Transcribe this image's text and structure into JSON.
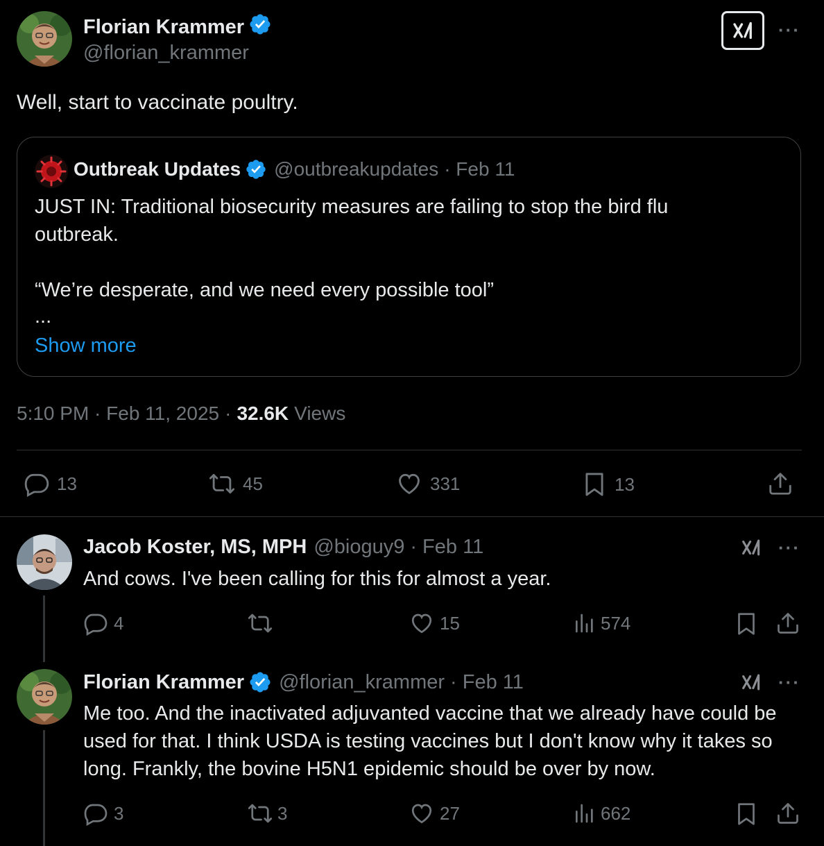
{
  "colors": {
    "background": "#000000",
    "text": "#e7e9ea",
    "muted": "#71767b",
    "accent": "#1d9bf0",
    "border": "#2f3336"
  },
  "main_tweet": {
    "author_name": "Florian Krammer",
    "author_handle": "@florian_krammer",
    "text": "Well, start to vaccinate poultry.",
    "timestamp": "5:10 PM · Feb 11, 2025",
    "views_count": "32.6K",
    "views_label": "Views",
    "quote": {
      "author_name": "Outbreak Updates",
      "author_handle": "@outbreakupdates",
      "date": "· Feb 11",
      "line1": "JUST IN: Traditional biosecurity measures are failing to stop the bird flu outbreak.",
      "line2": "“We’re desperate, and we need every possible tool”",
      "ellipsis": "...",
      "show_more": "Show more"
    },
    "actions": {
      "replies": "13",
      "reposts": "45",
      "likes": "331",
      "bookmarks": "13"
    }
  },
  "replies": [
    {
      "author_name": "Jacob Koster, MS, MPH",
      "author_handle": "@bioguy9",
      "date": "· Feb 11",
      "text": "And cows. I've been calling for this for almost a year.",
      "actions": {
        "replies": "4",
        "reposts": "",
        "likes": "15",
        "views": "574"
      }
    },
    {
      "author_name": "Florian Krammer",
      "author_handle": "@florian_krammer",
      "date": "· Feb 11",
      "text": "Me too. And the inactivated adjuvanted vaccine that we already have could be used for that. I think USDA is testing vaccines but I don't know why it takes so long. Frankly, the bovine H5N1 epidemic should be over by now.",
      "actions": {
        "replies": "3",
        "reposts": "3",
        "likes": "27",
        "views": "662"
      }
    }
  ],
  "icons": {
    "grok": "grok-icon",
    "more": "more-icon",
    "verified": "verified-badge-icon",
    "reply": "reply-icon",
    "repost": "repost-icon",
    "like": "like-icon",
    "bookmark": "bookmark-icon",
    "share": "share-icon",
    "views": "views-icon"
  },
  "more_glyph": "···"
}
